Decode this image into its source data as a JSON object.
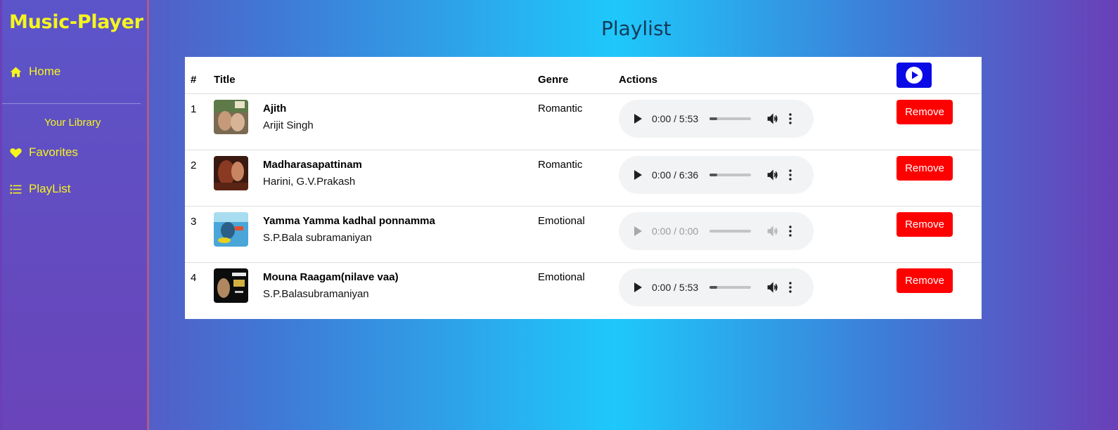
{
  "sidebar": {
    "brand": "Music-Player",
    "home_label": "Home",
    "library_label": "Your Library",
    "favorites_label": "Favorites",
    "playlist_label": "PlayList"
  },
  "page": {
    "title": "Playlist"
  },
  "table": {
    "headers": {
      "num": "#",
      "title": "Title",
      "genre": "Genre",
      "actions": "Actions"
    },
    "rows": [
      {
        "num": "1",
        "title": "Ajith",
        "artist": "Arijit Singh",
        "genre": "Romantic",
        "time": "0:00 / 5:53",
        "remove": "Remove",
        "progress": 0.18
      },
      {
        "num": "2",
        "title": "Madharasapattinam",
        "artist": "Harini, G.V.Prakash",
        "genre": "Romantic",
        "time": "0:00 / 6:36",
        "remove": "Remove",
        "progress": 0.18
      },
      {
        "num": "3",
        "title": "Yamma Yamma kadhal ponnamma",
        "artist": "S.P.Bala subramaniyan",
        "genre": "Emotional",
        "time": "0:00 / 0:00",
        "remove": "Remove",
        "progress": 0
      },
      {
        "num": "4",
        "title": "Mouna Raagam(nilave vaa)",
        "artist": "S.P.Balasubramaniyan",
        "genre": "Emotional",
        "time": "0:00 / 5:53",
        "remove": "Remove",
        "progress": 0.18
      }
    ]
  },
  "colors": {
    "brand": "#f5f51e",
    "remove_button": "#ff0000",
    "play_all_button": "#0a0ae6"
  },
  "icons": {
    "home": "home-icon",
    "favorites": "heart-icon",
    "playlist": "list-icon",
    "play_all": "play-circle-icon"
  }
}
